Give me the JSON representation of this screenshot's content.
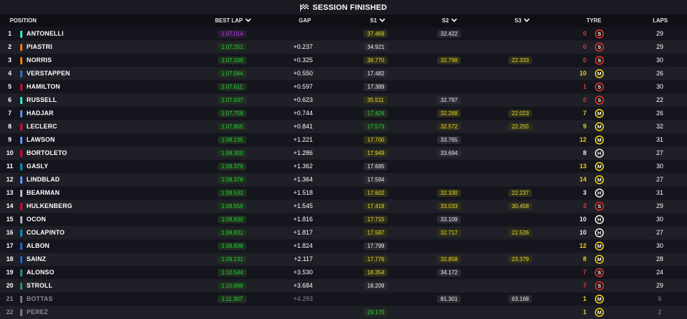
{
  "title": "SESSION FINISHED",
  "columns": {
    "position": "POSITION",
    "best_lap": "BEST LAP",
    "gap": "GAP",
    "s1": "S1",
    "s2": "S2",
    "s3": "S3",
    "tyre": "TYRE",
    "laps": "LAPS"
  },
  "colors": {
    "personal_best": "#28d23d",
    "overall_best": "#bd3ee8",
    "slower": "#e9dc2a"
  },
  "rows": [
    {
      "pos": "1",
      "name": "ANTONELLI",
      "team": "#27f4d2",
      "lap": "1:07.014",
      "lapc": "purple",
      "gap": "",
      "s1": "37.469",
      "s1c": "yellow",
      "s2": "32.422",
      "s2c": "white",
      "s3": "",
      "s3c": "",
      "tyre": "0",
      "tyrec": "red",
      "compound": "S",
      "laps": "29",
      "dim": false
    },
    {
      "pos": "2",
      "name": "PIASTRI",
      "team": "#ff8000",
      "lap": "1:07.251",
      "lapc": "green",
      "gap": "+0.237",
      "s1": "34.921",
      "s1c": "white",
      "s2": "",
      "s2c": "",
      "s3": "",
      "s3c": "",
      "tyre": "0",
      "tyrec": "red",
      "compound": "S",
      "laps": "29",
      "dim": false
    },
    {
      "pos": "3",
      "name": "NORRIS",
      "team": "#ff8000",
      "lap": "1:07.339",
      "lapc": "green",
      "gap": "+0.325",
      "s1": "36.770",
      "s1c": "yellow",
      "s2": "32.798",
      "s2c": "yellow",
      "s3": "22.333",
      "s3c": "yellow",
      "tyre": "0",
      "tyrec": "red",
      "compound": "S",
      "laps": "30",
      "dim": false
    },
    {
      "pos": "4",
      "name": "VERSTAPPEN",
      "team": "#3671c6",
      "lap": "1:07.564",
      "lapc": "green",
      "gap": "+0.550",
      "s1": "17.482",
      "s1c": "white",
      "s2": "",
      "s2c": "",
      "s3": "",
      "s3c": "",
      "tyre": "10",
      "tyrec": "yellow",
      "compound": "M",
      "laps": "26",
      "dim": false
    },
    {
      "pos": "5",
      "name": "HAMILTON",
      "team": "#e8002d",
      "lap": "1:07.611",
      "lapc": "green",
      "gap": "+0.597",
      "s1": "17.389",
      "s1c": "white",
      "s2": "",
      "s2c": "",
      "s3": "",
      "s3c": "",
      "tyre": "1",
      "tyrec": "red",
      "compound": "S",
      "laps": "30",
      "dim": false
    },
    {
      "pos": "6",
      "name": "RUSSELL",
      "team": "#27f4d2",
      "lap": "1:07.637",
      "lapc": "green",
      "gap": "+0.623",
      "s1": "35.511",
      "s1c": "yellow",
      "s2": "32.797",
      "s2c": "white",
      "s3": "",
      "s3c": "",
      "tyre": "0",
      "tyrec": "red",
      "compound": "S",
      "laps": "22",
      "dim": false
    },
    {
      "pos": "7",
      "name": "HADJAR",
      "team": "#6692ff",
      "lap": "1:07.758",
      "lapc": "green",
      "gap": "+0.744",
      "s1": "17.424",
      "s1c": "green",
      "s2": "32.268",
      "s2c": "yellow",
      "s3": "22.023",
      "s3c": "yellow",
      "tyre": "7",
      "tyrec": "yellow",
      "compound": "M",
      "laps": "26",
      "dim": false
    },
    {
      "pos": "8",
      "name": "LECLERC",
      "team": "#e8002d",
      "lap": "1:07.855",
      "lapc": "green",
      "gap": "+0.841",
      "s1": "17.573",
      "s1c": "green",
      "s2": "32.572",
      "s2c": "yellow",
      "s3": "22.255",
      "s3c": "yellow",
      "tyre": "9",
      "tyrec": "yellow",
      "compound": "M",
      "laps": "32",
      "dim": false
    },
    {
      "pos": "9",
      "name": "LAWSON",
      "team": "#6692ff",
      "lap": "1:08.235",
      "lapc": "green",
      "gap": "+1.221",
      "s1": "17.700",
      "s1c": "yellow",
      "s2": "33.765",
      "s2c": "white",
      "s3": "",
      "s3c": "",
      "tyre": "12",
      "tyrec": "yellow",
      "compound": "M",
      "laps": "31",
      "dim": false
    },
    {
      "pos": "10",
      "name": "BORTOLETO",
      "team": "#e8002d",
      "lap": "1:08.300",
      "lapc": "green",
      "gap": "+1.286",
      "s1": "17.949",
      "s1c": "yellow",
      "s2": "33.694",
      "s2c": "white",
      "s3": "",
      "s3c": "",
      "tyre": "8",
      "tyrec": "white",
      "compound": "H",
      "laps": "27",
      "dim": false
    },
    {
      "pos": "11",
      "name": "GASLY",
      "team": "#0093cc",
      "lap": "1:08.376",
      "lapc": "green",
      "gap": "+1.362",
      "s1": "17.695",
      "s1c": "white",
      "s2": "",
      "s2c": "",
      "s3": "",
      "s3c": "",
      "tyre": "13",
      "tyrec": "yellow",
      "compound": "M",
      "laps": "30",
      "dim": false
    },
    {
      "pos": "12",
      "name": "LINDBLAD",
      "team": "#6692ff",
      "lap": "1:08.378",
      "lapc": "green",
      "gap": "+1.364",
      "s1": "17.594",
      "s1c": "white",
      "s2": "",
      "s2c": "",
      "s3": "",
      "s3c": "",
      "tyre": "14",
      "tyrec": "yellow",
      "compound": "M",
      "laps": "27",
      "dim": false
    },
    {
      "pos": "13",
      "name": "BEARMAN",
      "team": "#b6babd",
      "lap": "1:08.532",
      "lapc": "green",
      "gap": "+1.518",
      "s1": "17.602",
      "s1c": "yellow",
      "s2": "32.330",
      "s2c": "yellow",
      "s3": "22.237",
      "s3c": "yellow",
      "tyre": "3",
      "tyrec": "white",
      "compound": "H",
      "laps": "31",
      "dim": false
    },
    {
      "pos": "14",
      "name": "HULKENBERG",
      "team": "#e8002d",
      "lap": "1:08.559",
      "lapc": "green",
      "gap": "+1.545",
      "s1": "17.419",
      "s1c": "yellow",
      "s2": "33.033",
      "s2c": "yellow",
      "s3": "30.458",
      "s3c": "yellow",
      "tyre": "3",
      "tyrec": "red",
      "compound": "S",
      "laps": "29",
      "dim": false
    },
    {
      "pos": "15",
      "name": "OCON",
      "team": "#b6babd",
      "lap": "1:08.830",
      "lapc": "green",
      "gap": "+1.816",
      "s1": "17.715",
      "s1c": "yellow",
      "s2": "33.109",
      "s2c": "white",
      "s3": "",
      "s3c": "",
      "tyre": "10",
      "tyrec": "white",
      "compound": "H",
      "laps": "30",
      "dim": false
    },
    {
      "pos": "16",
      "name": "COLAPINTO",
      "team": "#0093cc",
      "lap": "1:08.831",
      "lapc": "green",
      "gap": "+1.817",
      "s1": "17.587",
      "s1c": "yellow",
      "s2": "32.717",
      "s2c": "yellow",
      "s3": "22.526",
      "s3c": "yellow",
      "tyre": "10",
      "tyrec": "white",
      "compound": "H",
      "laps": "27",
      "dim": false
    },
    {
      "pos": "17",
      "name": "ALBON",
      "team": "#1868db",
      "lap": "1:08.838",
      "lapc": "green",
      "gap": "+1.824",
      "s1": "17.799",
      "s1c": "white",
      "s2": "",
      "s2c": "",
      "s3": "",
      "s3c": "",
      "tyre": "12",
      "tyrec": "yellow",
      "compound": "M",
      "laps": "30",
      "dim": false
    },
    {
      "pos": "18",
      "name": "SAINZ",
      "team": "#1868db",
      "lap": "1:09.131",
      "lapc": "green",
      "gap": "+2.117",
      "s1": "17.776",
      "s1c": "yellow",
      "s2": "32.858",
      "s2c": "yellow",
      "s3": "23.379",
      "s3c": "yellow",
      "tyre": "8",
      "tyrec": "yellow",
      "compound": "M",
      "laps": "28",
      "dim": false
    },
    {
      "pos": "19",
      "name": "ALONSO",
      "team": "#229971",
      "lap": "1:10.544",
      "lapc": "green",
      "gap": "+3.530",
      "s1": "18.354",
      "s1c": "yellow",
      "s2": "34.172",
      "s2c": "white",
      "s3": "",
      "s3c": "",
      "tyre": "7",
      "tyrec": "red",
      "compound": "S",
      "laps": "24",
      "dim": false
    },
    {
      "pos": "20",
      "name": "STROLL",
      "team": "#229971",
      "lap": "1:10.698",
      "lapc": "green",
      "gap": "+3.684",
      "s1": "18.209",
      "s1c": "white",
      "s2": "",
      "s2c": "",
      "s3": "",
      "s3c": "",
      "tyre": "7",
      "tyrec": "red",
      "compound": "S",
      "laps": "29",
      "dim": false
    },
    {
      "pos": "21",
      "name": "BOTTAS",
      "team": "#7a7a80",
      "lap": "1:11.307",
      "lapc": "green",
      "gap": "+4.293",
      "s1": "",
      "s1c": "",
      "s2": "81.301",
      "s2c": "white",
      "s3": "63.168",
      "s3c": "white",
      "tyre": "1",
      "tyrec": "yellow",
      "compound": "M",
      "laps": "6",
      "dim": true
    },
    {
      "pos": "22",
      "name": "PEREZ",
      "team": "#7a7a80",
      "lap": "",
      "lapc": "",
      "gap": "",
      "s1": "29.170",
      "s1c": "green",
      "s2": "",
      "s2c": "",
      "s3": "",
      "s3c": "",
      "tyre": "1",
      "tyrec": "yellow",
      "compound": "M",
      "laps": "2",
      "dim": true
    }
  ]
}
